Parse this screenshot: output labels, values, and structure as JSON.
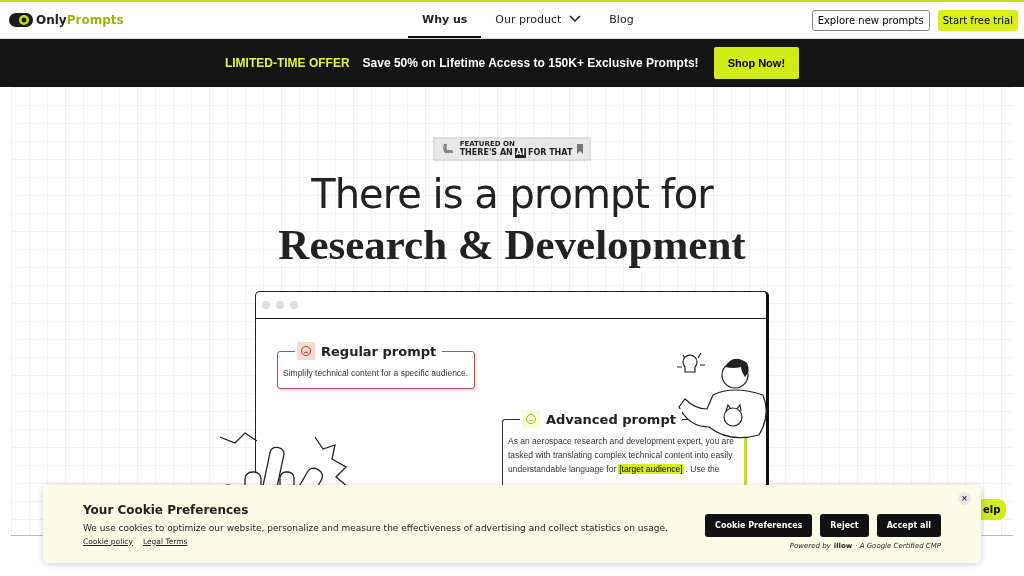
{
  "header": {
    "logo": {
      "first": "Only",
      "second": "Prompts"
    },
    "nav": [
      {
        "label": "Why us",
        "selected": true,
        "dropdown": false
      },
      {
        "label": "Our product",
        "selected": false,
        "dropdown": true
      },
      {
        "label": "Blog",
        "selected": false,
        "dropdown": false
      }
    ],
    "secondary_button": "Explore new prompts",
    "primary_button": "Start free trial"
  },
  "promo": {
    "tag": "LIMITED-TIME OFFER",
    "text": "Save 50% on Lifetime Access to 150K+ Exclusive Prompts!",
    "button": "Shop Now!"
  },
  "hero": {
    "badge": {
      "small": "FEATURED ON",
      "text_1": "THERE'S AN",
      "ai": "AI",
      "text_2": "FOR THAT"
    },
    "title_1": "There is a prompt for",
    "title_2": "Research & Development",
    "regular": {
      "title": "Regular prompt",
      "text": "Simplify technical content for a specific audience."
    },
    "advanced": {
      "title": "Advanced prompt",
      "text_before": "As an aerospace research and development expert, you are tasked with translating complex technical content into easily understandable language for",
      "highlight": "[target audience]",
      "text_after": ". Use the"
    }
  },
  "help_button": "elp",
  "cookie": {
    "title": "Your Cookie Preferences",
    "text": "We use cookies to optimize our website, personalize and measure the effectiveness of advertising and collect statistics on usage.",
    "links": [
      "Cookie policy",
      "Legal Terms"
    ],
    "buttons": [
      "Cookie Preferences",
      "Reject",
      "Accept all"
    ],
    "powered": "Powered by",
    "brand": "illow",
    "certified": "· A Google Certified CMP",
    "close": "×"
  }
}
